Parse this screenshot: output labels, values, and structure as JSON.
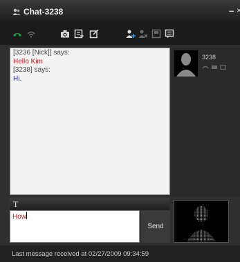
{
  "window": {
    "title": "Chat-3238",
    "minimize_label": "–",
    "close_label": "×"
  },
  "transcript": {
    "lines": [
      {
        "text": "[3236 [Nick]] says:",
        "color": "#444444"
      },
      {
        "text": "Hello Kim",
        "color": "#c01818"
      },
      {
        "text": "[3238] says:",
        "color": "#444444"
      },
      {
        "text": "Hi.",
        "color": "#2929b4"
      }
    ]
  },
  "contact": {
    "name": "3238"
  },
  "compose": {
    "font_label": "T",
    "input_value": "How",
    "send_label": "Send"
  },
  "status": {
    "text": "Last message received at 02/27/2009 09:34:59"
  },
  "toolbar": {
    "icons": [
      "phone-icon",
      "microphone-icon",
      "camera-icon",
      "send-file-icon",
      "edit-icon",
      "add-user-icon",
      "remove-user-icon",
      "save-icon",
      "chat-log-icon"
    ]
  },
  "colors": {
    "titlebar": "#2a2a2a",
    "toolbar": "#1b1b1b",
    "phone_green": "#1ea64b",
    "incoming_text": "#c01818",
    "outgoing_text": "#2929b4"
  }
}
